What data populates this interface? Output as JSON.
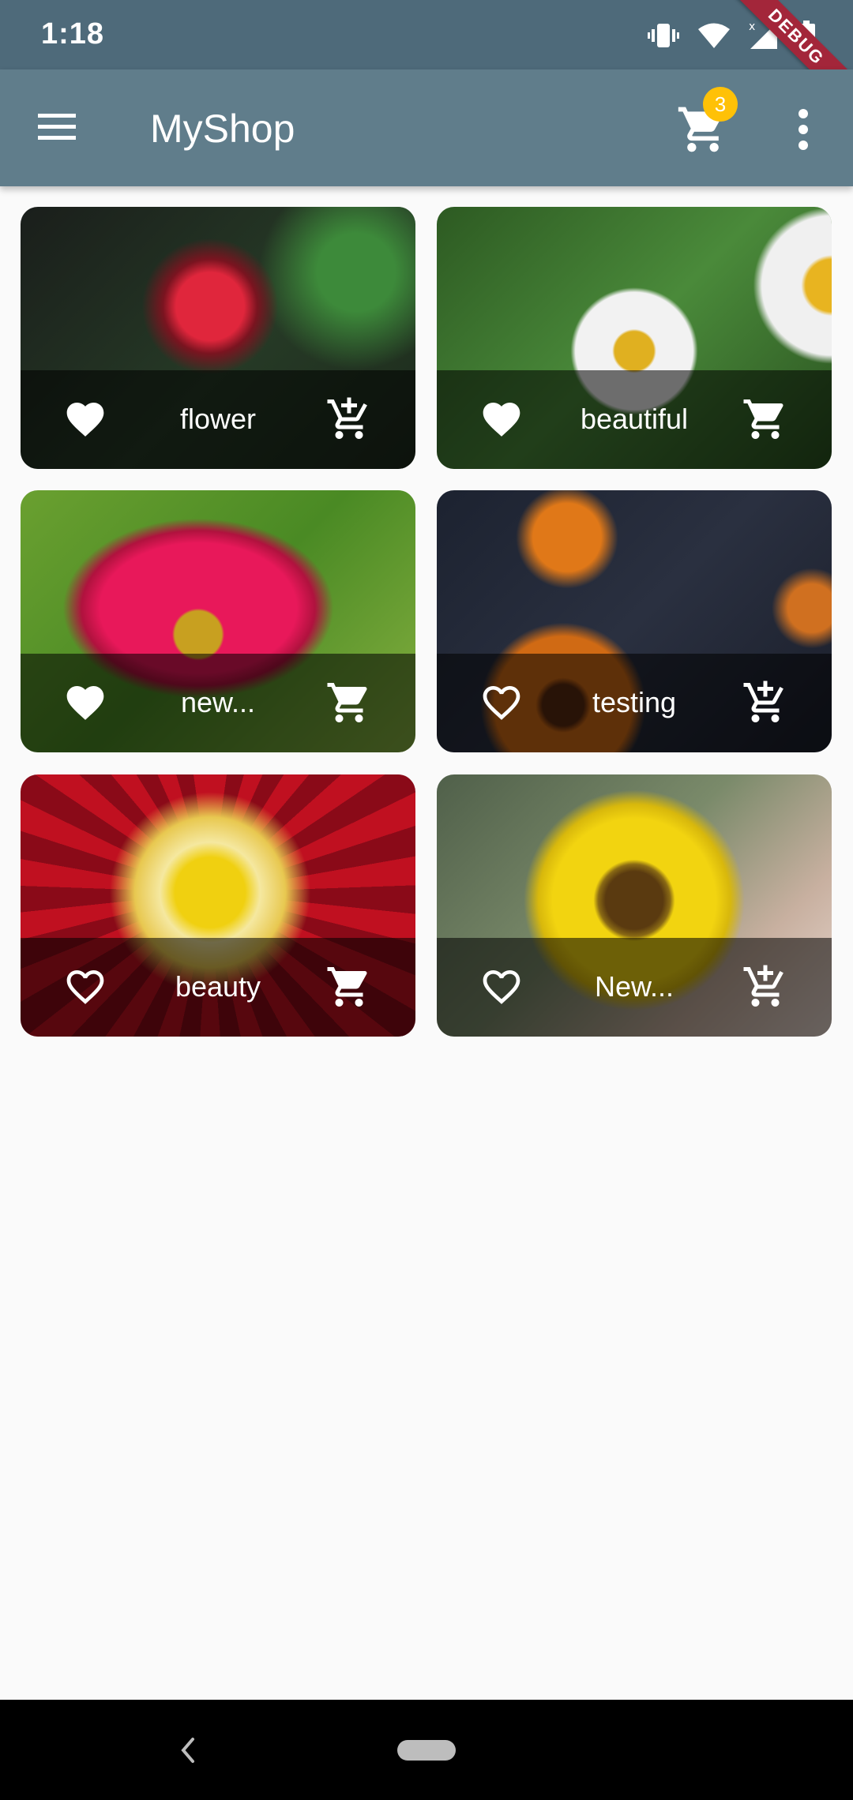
{
  "status_bar": {
    "time": "1:18",
    "debug_label": "DEBUG",
    "icons": [
      "vibrate-icon",
      "wifi-icon",
      "signal-icon",
      "battery-icon"
    ]
  },
  "app_bar": {
    "title": "MyShop",
    "cart_count": "3",
    "icons": [
      "menu-icon",
      "cart-icon",
      "more-vert-icon"
    ]
  },
  "products": [
    {
      "title": "flower",
      "favorite": true,
      "in_cart": false
    },
    {
      "title": "beautiful",
      "favorite": true,
      "in_cart": true
    },
    {
      "title": "new...",
      "favorite": true,
      "in_cart": true
    },
    {
      "title": "testing",
      "favorite": false,
      "in_cart": false
    },
    {
      "title": "beauty",
      "favorite": false,
      "in_cart": true
    },
    {
      "title": "New...",
      "favorite": false,
      "in_cart": false
    }
  ],
  "colors": {
    "status_bar": "#4e6a7a",
    "app_bar": "#607d8b",
    "badge": "#ffc107",
    "background": "#fafafa",
    "debug_ribbon": "#a3263a"
  },
  "nav_bar": {
    "icons": [
      "back-icon",
      "home-pill-icon"
    ]
  }
}
